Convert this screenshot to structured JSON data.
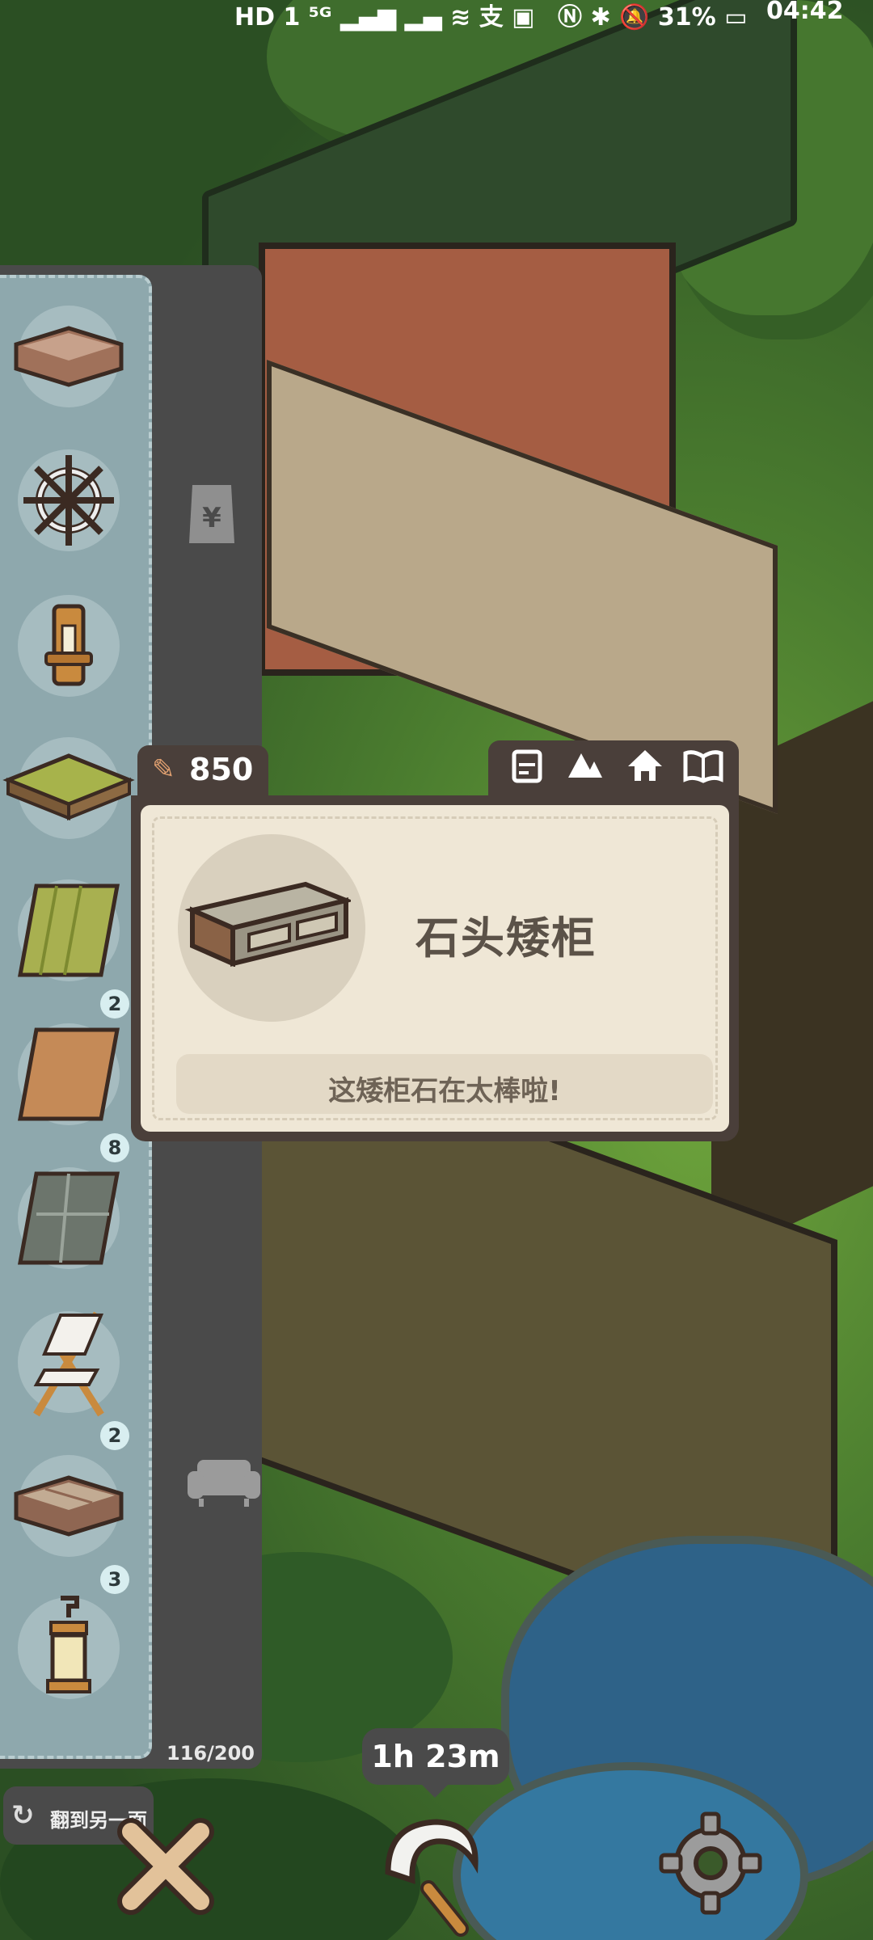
{
  "status_bar": {
    "left": "HD 1 ⁵ᴳ ▂▄▆ ▂▄ ≋ 支 ▣",
    "right": "Ⓝ ✱ 🔕 31% ▭",
    "time": "04:42"
  },
  "inventory": {
    "items": [
      {
        "name": "wooden-floor-tile",
        "count": ""
      },
      {
        "name": "ship-wheel",
        "count": ""
      },
      {
        "name": "wall-candle",
        "count": ""
      },
      {
        "name": "tatami-table",
        "count": ""
      },
      {
        "name": "bamboo-mat-roll",
        "count": "2"
      },
      {
        "name": "wood-rug-roll",
        "count": "8"
      },
      {
        "name": "stone-rug-roll",
        "count": "8"
      },
      {
        "name": "folding-chair",
        "count": "2"
      },
      {
        "name": "stone-floor-tile",
        "count": "3"
      },
      {
        "name": "hanging-lantern",
        "count": ""
      }
    ],
    "capacity": "116/200"
  },
  "card": {
    "carrot_value": "850",
    "item_name": "石头矮柜",
    "description": "这矮柜石在太棒啦!"
  },
  "controls": {
    "flip_label": "翻到另一面",
    "timer": "1h 23m"
  },
  "colors": {
    "panel": "#4a4a4a",
    "inventory_bg": "#8ea8ad",
    "card_bg": "#efe7d6",
    "card_border": "#4a3f3a"
  }
}
